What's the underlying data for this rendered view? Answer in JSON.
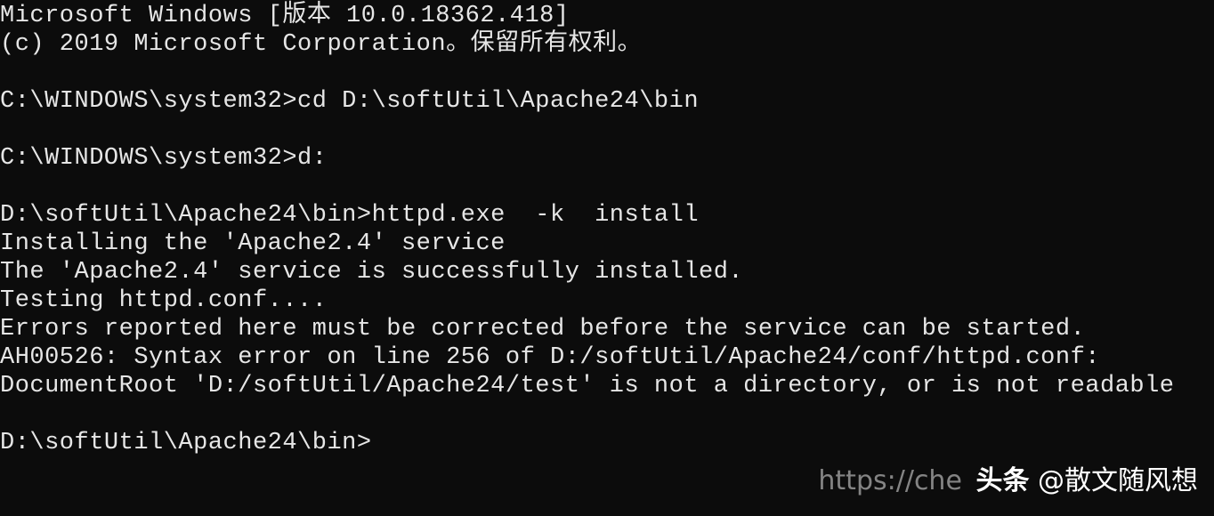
{
  "window": {
    "type": "command-prompt",
    "background": "#0c0c0c",
    "foreground": "#e6e6e6"
  },
  "console": {
    "lines": [
      "Microsoft Windows [版本 10.0.18362.418]",
      "(c) 2019 Microsoft Corporation。保留所有权利。",
      "",
      "C:\\WINDOWS\\system32>cd D:\\softUtil\\Apache24\\bin",
      "",
      "C:\\WINDOWS\\system32>d:",
      "",
      "D:\\softUtil\\Apache24\\bin>httpd.exe  -k  install",
      "Installing the 'Apache2.4' service",
      "The 'Apache2.4' service is successfully installed.",
      "Testing httpd.conf....",
      "Errors reported here must be corrected before the service can be started.",
      "AH00526: Syntax error on line 256 of D:/softUtil/Apache24/conf/httpd.conf:",
      "DocumentRoot 'D:/softUtil/Apache24/test' is not a directory, or is not readable",
      "",
      "D:\\softUtil\\Apache24\\bin>"
    ]
  },
  "watermark": {
    "url": "https://che",
    "brand": "头条",
    "author": "@散文随风想"
  }
}
